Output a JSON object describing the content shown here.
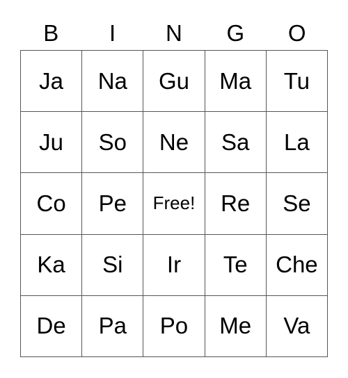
{
  "header": [
    "B",
    "I",
    "N",
    "G",
    "O"
  ],
  "rows": [
    [
      "Ja",
      "Na",
      "Gu",
      "Ma",
      "Tu"
    ],
    [
      "Ju",
      "So",
      "Ne",
      "Sa",
      "La"
    ],
    [
      "Co",
      "Pe",
      "Free!",
      "Re",
      "Se"
    ],
    [
      "Ka",
      "Si",
      "Ir",
      "Te",
      "Che"
    ],
    [
      "De",
      "Pa",
      "Po",
      "Me",
      "Va"
    ]
  ]
}
